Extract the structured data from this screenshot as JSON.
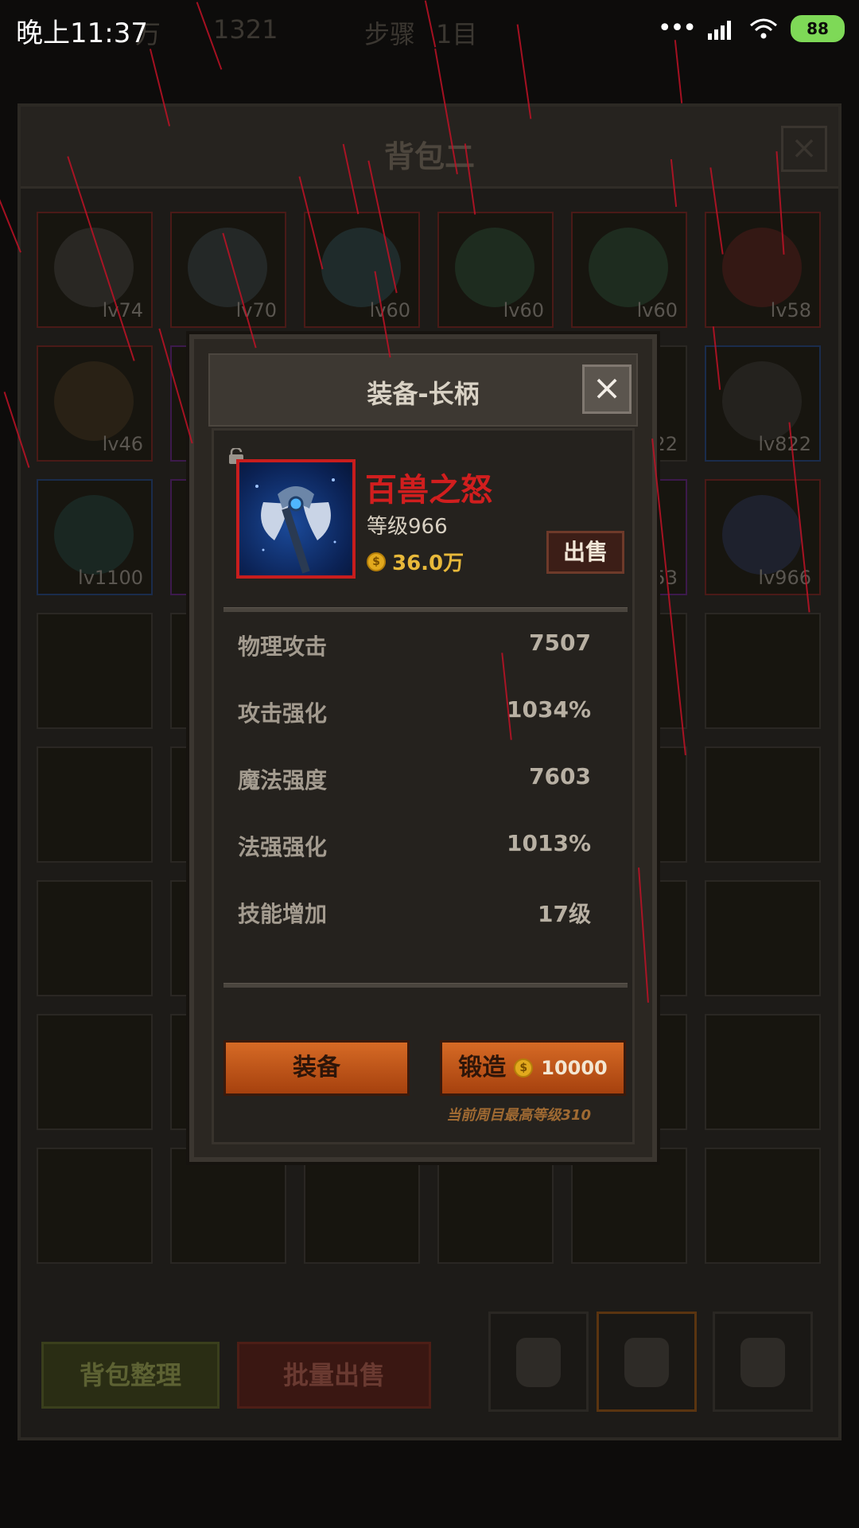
{
  "status_bar": {
    "time": "晚上11:37",
    "battery": "88"
  },
  "hud": {
    "fragments": [
      "万",
      "1321",
      "步骤",
      "1目"
    ]
  },
  "bag": {
    "title": "背包二",
    "slots": [
      {
        "level": "lv74"
      },
      {
        "level": "lv70"
      },
      {
        "level": "lv60"
      },
      {
        "level": "lv60"
      },
      {
        "level": "lv60"
      },
      {
        "level": "lv58"
      },
      {
        "level": "lv46"
      },
      {
        "level": ""
      },
      {
        "level": ""
      },
      {
        "level": ""
      },
      {
        "level": "22"
      },
      {
        "level": "lv822"
      },
      {
        "level": "lv1100"
      },
      {
        "level": ""
      },
      {
        "level": ""
      },
      {
        "level": ""
      },
      {
        "level": "53"
      },
      {
        "level": "lv966"
      }
    ],
    "sort_button": "背包整理",
    "batch_sell_button": "批量出售"
  },
  "modal": {
    "title": "装备-长柄",
    "item": {
      "name": "百兽之怒",
      "level": "等级966",
      "price": "36.0万",
      "coin_symbol": "$"
    },
    "sell_button": "出售",
    "stats": [
      {
        "label": "物理攻击",
        "value": "7507"
      },
      {
        "label": "攻击强化",
        "value": "1034%"
      },
      {
        "label": "魔法强度",
        "value": "7603"
      },
      {
        "label": "法强强化",
        "value": "1013%"
      },
      {
        "label": "技能增加",
        "value": "17级"
      }
    ],
    "equip_button": "装备",
    "forge_button": "锻造",
    "forge_cost": "10000",
    "hint": "当前周目最高等级310"
  },
  "colors": {
    "item_name": "#d11e1e",
    "price": "#e8b93a",
    "action_button": "#c05a1c",
    "rain": "#c01226"
  }
}
